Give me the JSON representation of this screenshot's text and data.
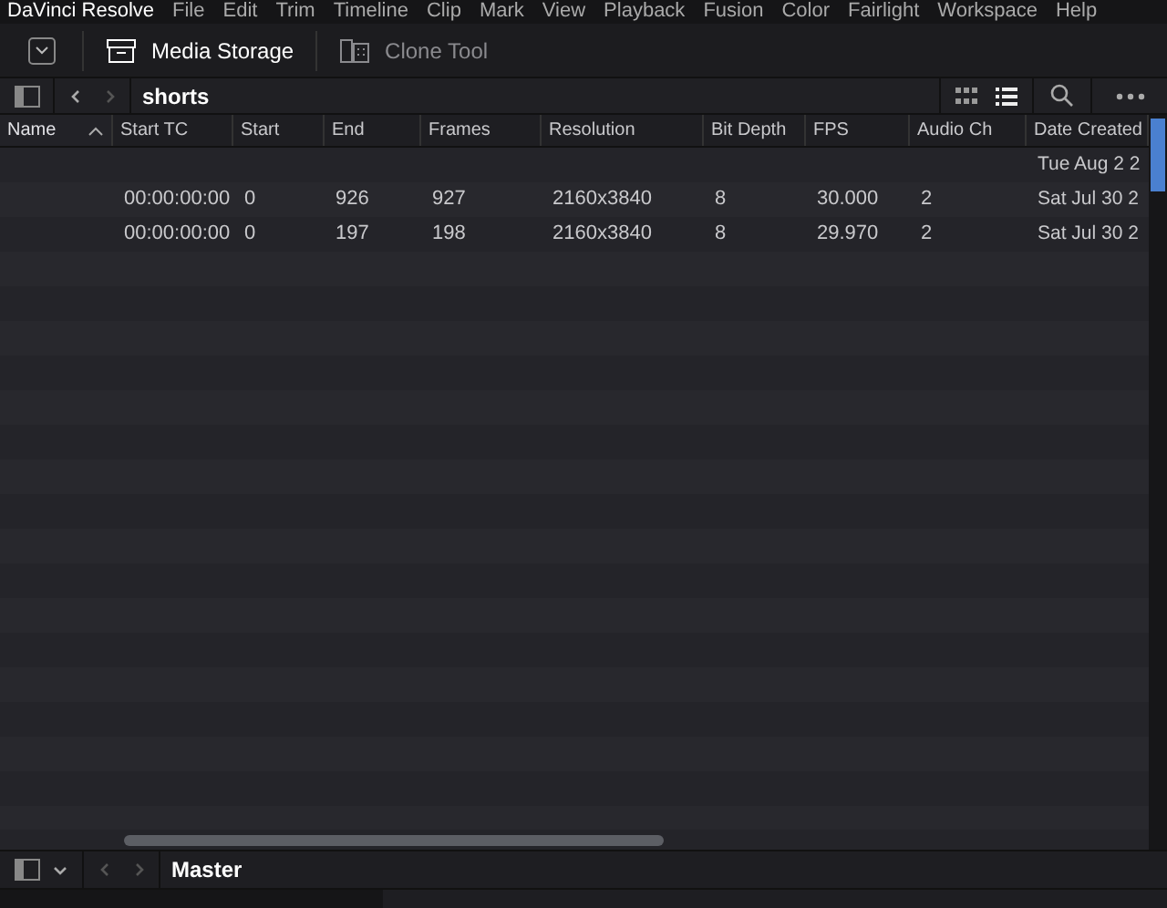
{
  "menu_bar": {
    "app_name": "DaVinci Resolve",
    "items": [
      "File",
      "Edit",
      "Trim",
      "Timeline",
      "Clip",
      "Mark",
      "View",
      "Playback",
      "Fusion",
      "Color",
      "Fairlight",
      "Workspace",
      "Help"
    ]
  },
  "toolbar": {
    "buttons": [
      {
        "label": "Media Storage",
        "selected": true
      },
      {
        "label": "Clone Tool",
        "selected": false
      }
    ]
  },
  "browser": {
    "path": "shorts",
    "view_buttons": [
      {
        "selected": false
      },
      {
        "selected": true
      }
    ]
  },
  "table": {
    "columns": [
      {
        "label": "Name",
        "sorted": true
      },
      {
        "label": "Start TC",
        "sorted": false
      },
      {
        "label": "Start",
        "sorted": false
      },
      {
        "label": "End",
        "sorted": false
      },
      {
        "label": "Frames",
        "sorted": false
      },
      {
        "label": "Resolution",
        "sorted": false
      },
      {
        "label": "Bit Depth",
        "sorted": false
      },
      {
        "label": "FPS",
        "sorted": false
      },
      {
        "label": "Audio Ch",
        "sorted": false
      },
      {
        "label": "Date Created",
        "sorted": false
      }
    ],
    "rows": [
      [
        "",
        "",
        "",
        "",
        "",
        "",
        "",
        "",
        "",
        "Tue Aug 2 2"
      ],
      [
        "",
        "00:00:00:00",
        "0",
        "926",
        "927",
        "2160x3840",
        "8",
        "30.000",
        "2",
        "Sat Jul 30 2"
      ],
      [
        "",
        "00:00:00:00",
        "0",
        "197",
        "198",
        "2160x3840",
        "8",
        "29.970",
        "2",
        "Sat Jul 30 2"
      ]
    ]
  },
  "bin_bar": {
    "title": "Master"
  }
}
